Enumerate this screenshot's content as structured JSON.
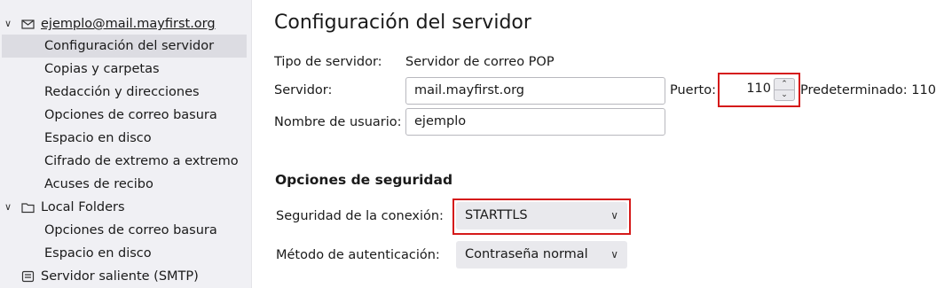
{
  "sidebar": {
    "account": {
      "name": "ejemplo@mail.mayfirst.org",
      "items": [
        "Configuración del servidor",
        "Copias y carpetas",
        "Redacción y direcciones",
        "Opciones de correo basura",
        "Espacio en disco",
        "Cifrado de extremo a extremo",
        "Acuses de recibo"
      ],
      "selected": "Configuración del servidor"
    },
    "local_folders": {
      "name": "Local Folders",
      "items": [
        "Opciones de correo basura",
        "Espacio en disco"
      ]
    },
    "outgoing": "Servidor saliente (SMTP)"
  },
  "main": {
    "title": "Configuración del servidor",
    "server_type_label": "Tipo de servidor:",
    "server_type_value": "Servidor de correo POP",
    "server_label": "Servidor:",
    "server_value": "mail.mayfirst.org",
    "port_label": "Puerto:",
    "port_value": "110",
    "port_default": "Predeterminado: 110",
    "username_label": "Nombre de usuario:",
    "username_value": "ejemplo",
    "security_heading": "Opciones de seguridad",
    "conn_security_label": "Seguridad de la conexión:",
    "conn_security_value": "STARTTLS",
    "auth_method_label": "Método de autenticación:",
    "auth_method_value": "Contraseña normal"
  },
  "colors": {
    "highlight": "#d51a1a",
    "sidebar_bg": "#f0f0f4",
    "selected_bg": "#dcdce2"
  }
}
